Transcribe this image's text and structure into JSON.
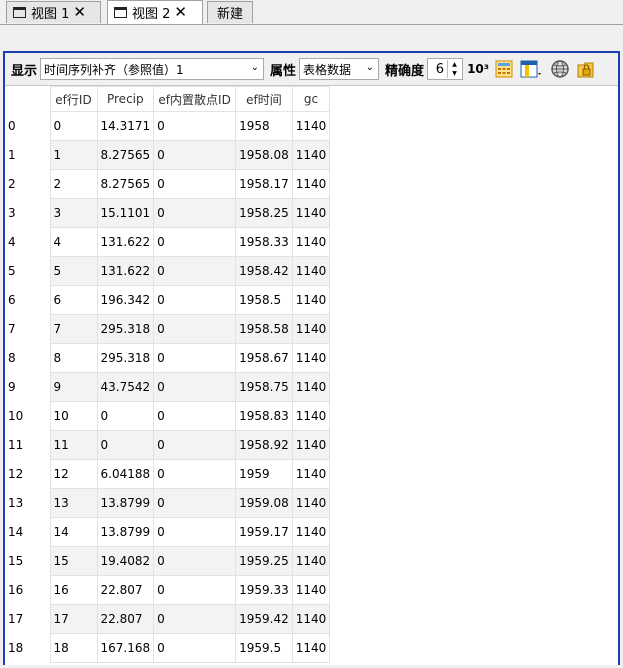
{
  "tabs": [
    {
      "label": "视图 1",
      "icon": "window-icon",
      "closable": true
    },
    {
      "label": "视图 2",
      "icon": "window-icon",
      "closable": true,
      "active": true
    },
    {
      "label": "新建"
    }
  ],
  "toolbar": {
    "display_label": "显示",
    "display_value": "时间序列补齐（参照值）1",
    "attr_label": "属性",
    "attr_value": "表格数据",
    "precision_label": "精确度",
    "precision_value": "6",
    "sci_label": "10³",
    "icons": [
      "calculator-icon",
      "column-chooser-icon",
      "globe-icon",
      "folder-lock-icon"
    ]
  },
  "table": {
    "columns": [
      "ef行ID",
      "Precip",
      "ef内置散点ID",
      "ef时间",
      "gc"
    ],
    "rows": [
      [
        "0",
        "0",
        "14.3171",
        "0",
        "1958",
        "1140"
      ],
      [
        "1",
        "1",
        "8.27565",
        "0",
        "1958.08",
        "1140"
      ],
      [
        "2",
        "2",
        "8.27565",
        "0",
        "1958.17",
        "1140"
      ],
      [
        "3",
        "3",
        "15.1101",
        "0",
        "1958.25",
        "1140"
      ],
      [
        "4",
        "4",
        "131.622",
        "0",
        "1958.33",
        "1140"
      ],
      [
        "5",
        "5",
        "131.622",
        "0",
        "1958.42",
        "1140"
      ],
      [
        "6",
        "6",
        "196.342",
        "0",
        "1958.5",
        "1140"
      ],
      [
        "7",
        "7",
        "295.318",
        "0",
        "1958.58",
        "1140"
      ],
      [
        "8",
        "8",
        "295.318",
        "0",
        "1958.67",
        "1140"
      ],
      [
        "9",
        "9",
        "43.7542",
        "0",
        "1958.75",
        "1140"
      ],
      [
        "10",
        "10",
        "0",
        "0",
        "1958.83",
        "1140"
      ],
      [
        "11",
        "11",
        "0",
        "0",
        "1958.92",
        "1140"
      ],
      [
        "12",
        "12",
        "6.04188",
        "0",
        "1959",
        "1140"
      ],
      [
        "13",
        "13",
        "13.8799",
        "0",
        "1959.08",
        "1140"
      ],
      [
        "14",
        "14",
        "13.8799",
        "0",
        "1959.17",
        "1140"
      ],
      [
        "15",
        "15",
        "19.4082",
        "0",
        "1959.25",
        "1140"
      ],
      [
        "16",
        "16",
        "22.807",
        "0",
        "1959.33",
        "1140"
      ],
      [
        "17",
        "17",
        "22.807",
        "0",
        "1959.42",
        "1140"
      ],
      [
        "18",
        "18",
        "167.168",
        "0",
        "1959.5",
        "1140"
      ]
    ]
  },
  "colors": {
    "frame_border": "#1f3fae",
    "alt_row": "#f3f3f3"
  }
}
